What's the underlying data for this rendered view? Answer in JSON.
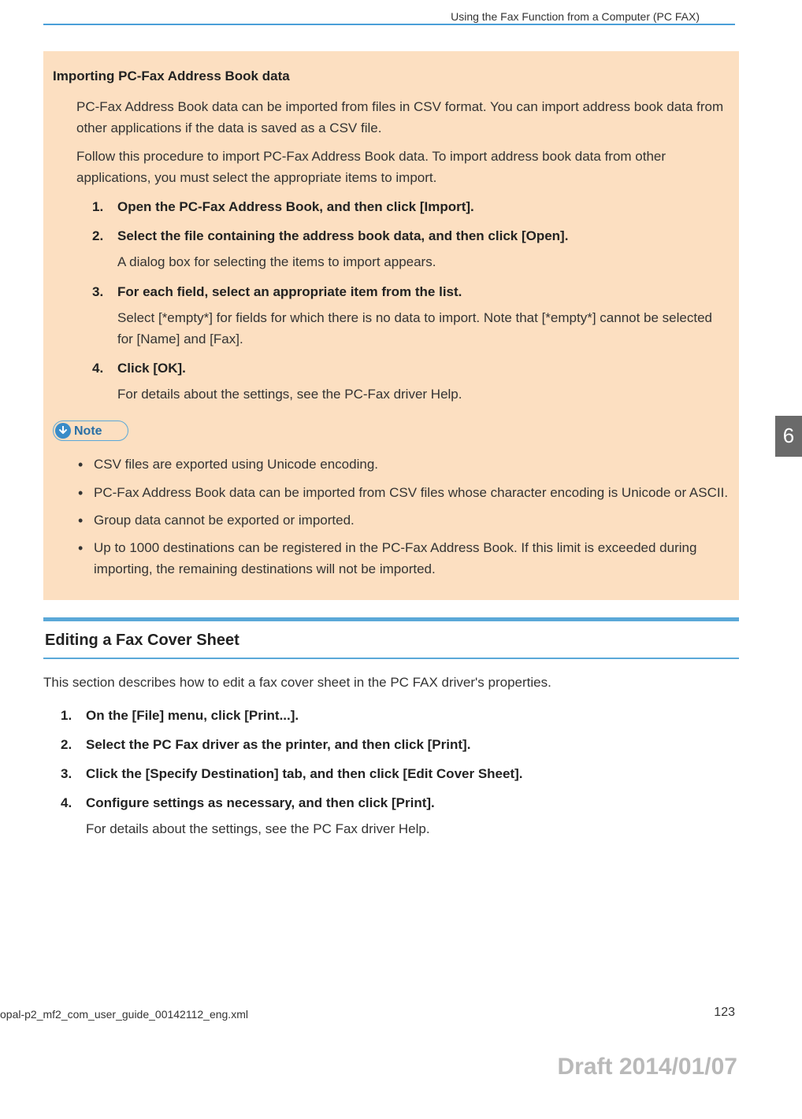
{
  "header": {
    "title": "Using the Fax Function from a Computer (PC FAX)"
  },
  "importing": {
    "heading": "Importing PC-Fax Address Book data",
    "para1": "PC-Fax Address Book data can be imported from files in CSV format. You can import address book data from other applications if the data is saved as a CSV file.",
    "para2": "Follow this procedure to import PC-Fax Address Book data. To import address book data from other applications, you must select the appropriate items to import.",
    "step1": "Open the PC-Fax Address Book, and then click [Import].",
    "step2": "Select the file containing the address book data, and then click [Open].",
    "step2_detail": "A dialog box for selecting the items to import appears.",
    "step3": "For each field, select an appropriate item from the list.",
    "step3_detail": "Select [*empty*] for fields for which there is no data to import. Note that [*empty*] cannot be selected for [Name] and [Fax].",
    "step4": "Click [OK].",
    "step4_detail": "For details about the settings, see the PC-Fax driver Help."
  },
  "note": {
    "label": "Note",
    "item1": "CSV files are exported using Unicode encoding.",
    "item2": "PC-Fax Address Book data can be imported from CSV files whose character encoding is Unicode or ASCII.",
    "item3": "Group data cannot be exported or imported.",
    "item4": "Up to 1000 destinations can be registered in the PC-Fax Address Book. If this limit is exceeded during importing, the remaining destinations will not be imported."
  },
  "editing": {
    "heading": "Editing a Fax Cover Sheet",
    "intro": "This section describes how to edit a fax cover sheet in the PC FAX driver's properties.",
    "step1": "On the [File] menu, click [Print...].",
    "step2": "Select the PC Fax driver as the printer, and then click [Print].",
    "step3": "Click the [Specify Destination] tab, and then click [Edit Cover Sheet].",
    "step4": "Configure settings as necessary, and then click [Print].",
    "step4_detail": "For details about the settings, see the PC Fax driver Help."
  },
  "chapter": "6",
  "footer": {
    "file": "opal-p2_mf2_com_user_guide_00142112_eng.xml",
    "page": "123"
  },
  "draft": "Draft 2014/01/07"
}
